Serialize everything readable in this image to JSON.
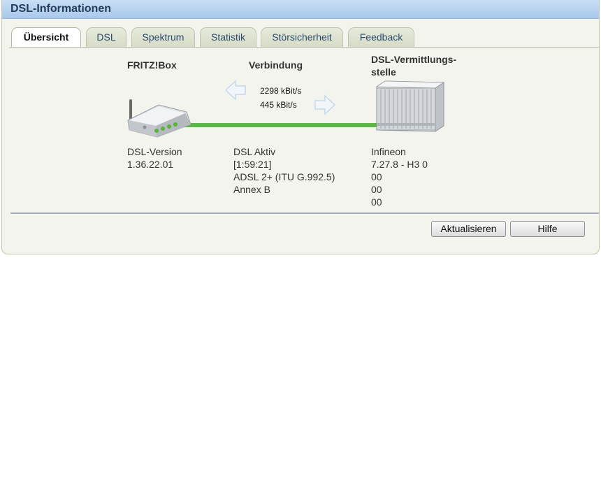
{
  "window": {
    "title": "DSL-Informationen"
  },
  "tabs": [
    {
      "label": "Übersicht",
      "active": true
    },
    {
      "label": "DSL"
    },
    {
      "label": "Spektrum"
    },
    {
      "label": "Statistik"
    },
    {
      "label": "Störsicherheit"
    },
    {
      "label": "Feedback"
    }
  ],
  "overview": {
    "fritzbox": {
      "title": "FRITZ!Box",
      "icon": "router-icon",
      "label": "DSL-Version",
      "version": "1.36.22.01"
    },
    "connection": {
      "title": "Verbindung",
      "downstream": "2298 kBit/s",
      "upstream": "445 kBit/s",
      "status": "DSL Aktiv",
      "duration": "[1:59:21]",
      "mode": "ADSL 2+ (ITU G.992.5)",
      "annex": "Annex B",
      "line_color": "#5cb548"
    },
    "dslam": {
      "title_line1": "DSL-Vermittlungs-",
      "title_line2": "stelle",
      "icon": "dslam-icon",
      "vendor": "Infineon",
      "version": "7.27.8 - H3 0",
      "values": [
        "00",
        "00",
        "00"
      ]
    }
  },
  "buttons": {
    "refresh": "Aktualisieren",
    "help": "Hilfe"
  }
}
